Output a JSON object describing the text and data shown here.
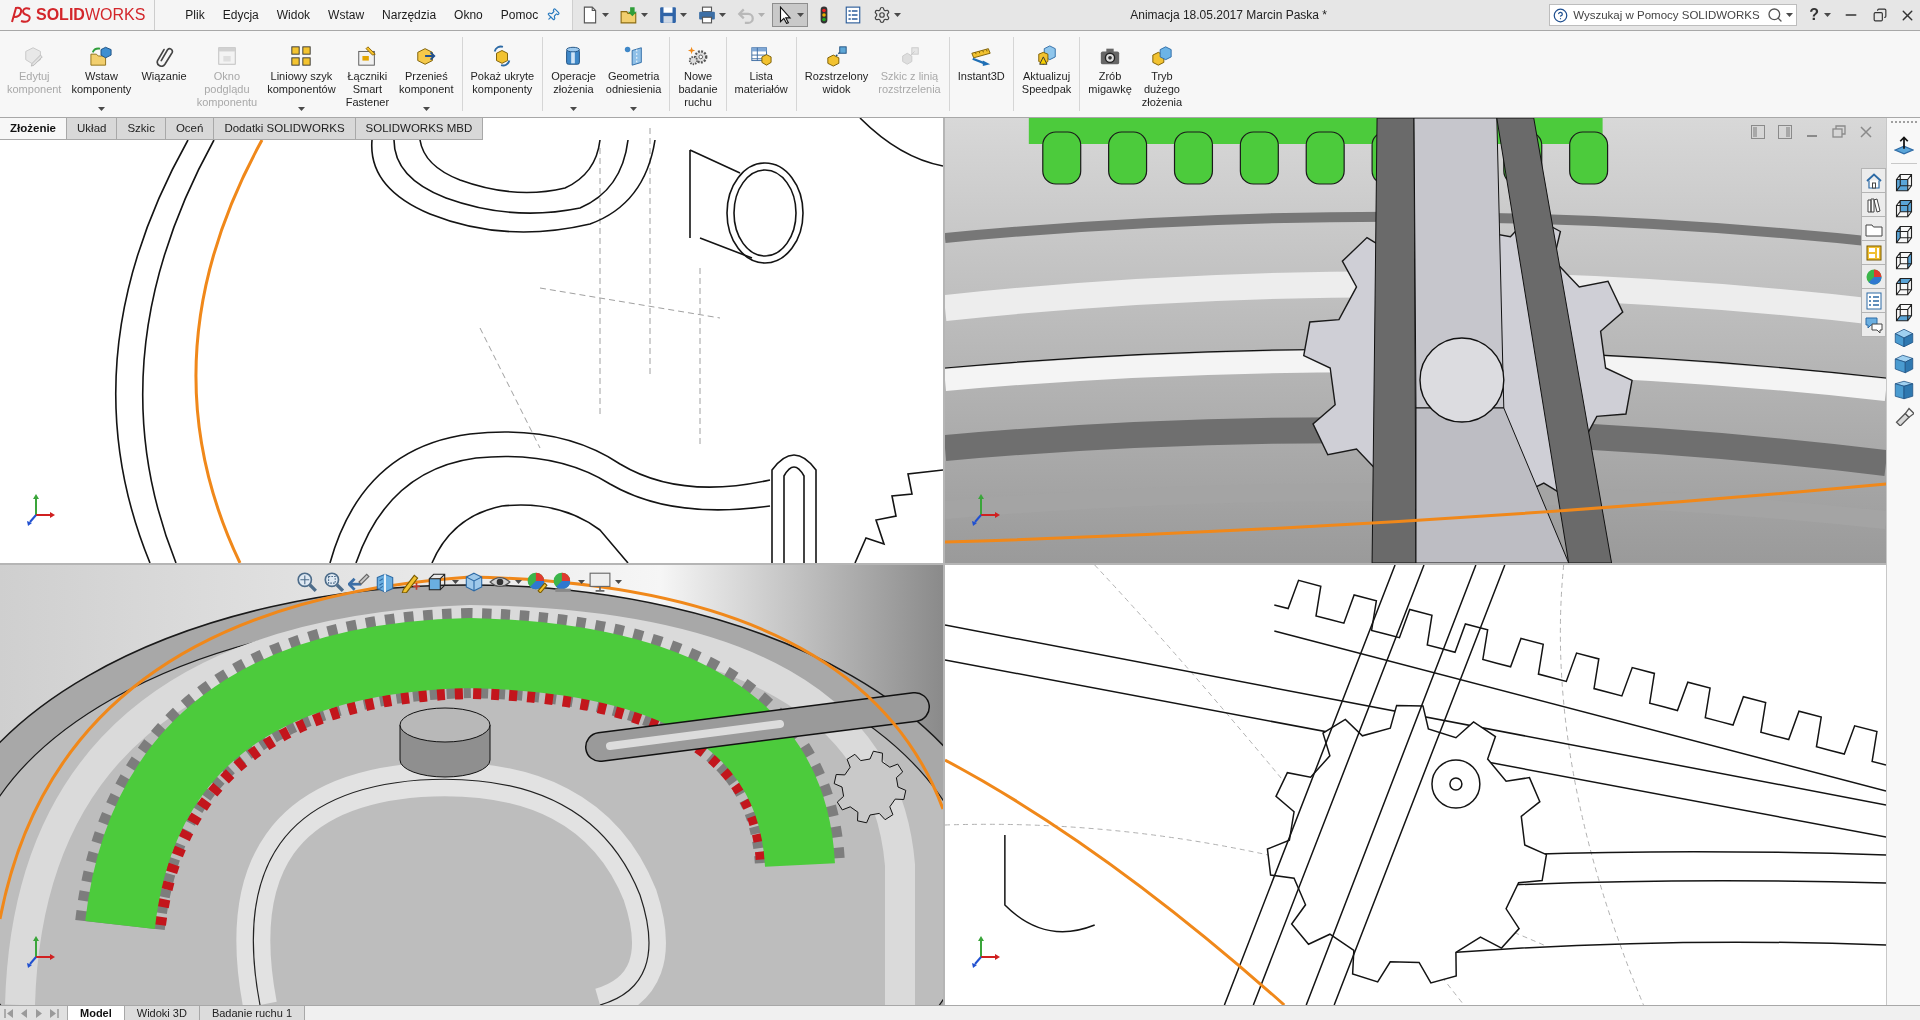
{
  "title_bar": {
    "logo": "**SOLID**WORKS",
    "menu": [
      "Plik",
      "Edycja",
      "Widok",
      "Wstaw",
      "Narzędzia",
      "Okno",
      "Pomoc"
    ],
    "quick_access": [
      {
        "kind": "new",
        "dropdown": true,
        "disabled": false,
        "pressed": false
      },
      {
        "kind": "open",
        "dropdown": true,
        "disabled": false,
        "pressed": false
      },
      {
        "kind": "save",
        "dropdown": true,
        "disabled": false,
        "pressed": false
      },
      {
        "kind": "print",
        "dropdown": true,
        "disabled": false,
        "pressed": false
      },
      {
        "kind": "undo",
        "dropdown": true,
        "disabled": true,
        "pressed": false
      },
      {
        "kind": "select",
        "dropdown": true,
        "disabled": false,
        "pressed": true
      },
      {
        "kind": "rebuild",
        "dropdown": false,
        "disabled": false,
        "pressed": false
      },
      {
        "kind": "properties",
        "dropdown": false,
        "disabled": false,
        "pressed": false
      },
      {
        "kind": "options",
        "dropdown": true,
        "disabled": false,
        "pressed": false
      }
    ],
    "document_title": "Animacja 18.05.2017 Marcin Paska *",
    "help_search": {
      "placeholder": "Wyszukaj w Pomocy SOLIDWORKS"
    },
    "help_menu": "?"
  },
  "ribbon": {
    "groups": [
      {
        "commands": [
          {
            "kind": "edit-component",
            "label": "Edytuj\nkomponent",
            "disabled": true,
            "dropdown": false
          },
          {
            "kind": "insert-components",
            "label": "Wstaw\nkomponenty",
            "disabled": false,
            "dropdown": true
          },
          {
            "kind": "mate",
            "label": "Wiązanie",
            "disabled": false,
            "dropdown": false
          },
          {
            "kind": "preview-window",
            "label": "Okno\npodglądu\nkomponentu",
            "disabled": true,
            "dropdown": false
          },
          {
            "kind": "pattern",
            "label": "Liniowy szyk\nkomponentów",
            "disabled": false,
            "dropdown": true
          },
          {
            "kind": "smart-fasteners",
            "label": "Łączniki\nSmart\nFastener",
            "disabled": false,
            "dropdown": false
          },
          {
            "kind": "move-component",
            "label": "Przenieś\nkomponent",
            "disabled": false,
            "dropdown": true
          }
        ]
      },
      {
        "commands": [
          {
            "kind": "show-hidden",
            "label": "Pokaż ukryte\nkomponenty",
            "disabled": false,
            "dropdown": false
          }
        ]
      },
      {
        "commands": [
          {
            "kind": "assembly-features",
            "label": "Operacje\nzłożenia",
            "disabled": false,
            "dropdown": true
          },
          {
            "kind": "reference-geometry",
            "label": "Geometria\nodniesienia",
            "disabled": false,
            "dropdown": true
          }
        ]
      },
      {
        "commands": [
          {
            "kind": "motion-study",
            "label": "Nowe\nbadanie\nruchu",
            "disabled": false,
            "dropdown": false
          }
        ]
      },
      {
        "commands": [
          {
            "kind": "bom",
            "label": "Lista\nmateriałów",
            "disabled": false,
            "dropdown": false
          }
        ]
      },
      {
        "commands": [
          {
            "kind": "exploded-view",
            "label": "Rozstrzelony\nwidok",
            "disabled": false,
            "dropdown": false
          },
          {
            "kind": "explode-line",
            "label": "Szkic z linią\nrozstrzelenia",
            "disabled": true,
            "dropdown": false
          }
        ]
      },
      {
        "commands": [
          {
            "kind": "instant3d",
            "label": "Instant3D",
            "disabled": false,
            "dropdown": false
          }
        ]
      },
      {
        "commands": [
          {
            "kind": "speedpak",
            "label": "Aktualizuj\nSpeedpak",
            "disabled": false,
            "dropdown": false
          }
        ]
      },
      {
        "commands": [
          {
            "kind": "snapshot",
            "label": "Zrób\nmigawkę",
            "disabled": false,
            "dropdown": false
          },
          {
            "kind": "large-assembly",
            "label": "Tryb\ndużego\nzłożenia",
            "disabled": false,
            "dropdown": false
          }
        ]
      }
    ]
  },
  "command_tabs": [
    {
      "label": "Złożenie",
      "selected": true
    },
    {
      "label": "Układ",
      "selected": false
    },
    {
      "label": "Szkic",
      "selected": false
    },
    {
      "label": "Oceń",
      "selected": false
    },
    {
      "label": "Dodatki SOLIDWORKS",
      "selected": false
    },
    {
      "label": "SOLIDWORKS MBD",
      "selected": false
    }
  ],
  "viewports": [
    {
      "kind": "edges-front",
      "active": false
    },
    {
      "kind": "shaded-closeup",
      "active": true
    },
    {
      "kind": "shaded-iso",
      "active": false,
      "toolbar": [
        {
          "kind": "zoom-fit"
        },
        {
          "kind": "zoom-area"
        },
        {
          "kind": "previous-view"
        },
        {
          "kind": "section-view"
        },
        {
          "kind": "dynamic-annotation"
        },
        {
          "kind": "view-orientation"
        },
        {
          "kind": "caret"
        },
        {
          "kind": "display-style"
        },
        {
          "kind": "hide-show"
        },
        {
          "kind": "caret"
        },
        {
          "kind": "edit-appearance"
        },
        {
          "kind": "apply-scene"
        },
        {
          "kind": "caret"
        },
        {
          "kind": "view-settings"
        },
        {
          "kind": "caret"
        }
      ]
    },
    {
      "kind": "edges-closeup",
      "active": false
    }
  ],
  "bottom_tabs": [
    {
      "label": "Model",
      "selected": true
    },
    {
      "label": "Widoki 3D",
      "selected": false
    },
    {
      "label": "Badanie ruchu 1",
      "selected": false
    }
  ]
}
